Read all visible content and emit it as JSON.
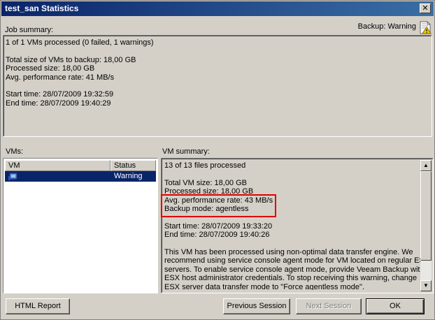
{
  "window": {
    "title": "test_san Statistics",
    "close_glyph": "✕"
  },
  "job": {
    "label": "Job summary:",
    "backup_label": "Backup:",
    "backup_status": "Warning",
    "lines": [
      "1 of 1 VMs processed (0 failed, 1 warnings)",
      "",
      "Total size of VMs to backup: 18,00 GB",
      "Processed size: 18,00 GB",
      "Avg. performance rate: 41 MB/s",
      "",
      "Start time: 28/07/2009 19:32:59",
      "End time: 28/07/2009 19:40:29"
    ]
  },
  "vms": {
    "label": "VMs:",
    "columns": [
      "VM",
      "Status"
    ],
    "rows": [
      {
        "name": "",
        "status": "Warning"
      }
    ]
  },
  "vm_summary": {
    "label": "VM summary:",
    "lines": [
      "13 of 13 files processed",
      "",
      "Total VM size: 18,00 GB",
      "Processed size: 18,00 GB",
      "Avg. performance rate: 43 MB/s",
      "Backup mode: agentless",
      "",
      "Start time: 28/07/2009 19:33:20",
      "End time: 28/07/2009 19:40:26",
      "",
      "This VM has been processed using non-optimal data transfer engine. We",
      "recommend using service console agent mode for VM located on regular ESX",
      "servers. To enable service console agent mode, provide Veeam Backup with",
      "ESX host administrator credentials. To stop receiving this warning, change",
      "ESX server data transfer mode to \"Force agentless mode\"."
    ]
  },
  "buttons": {
    "html_report": "HTML Report",
    "previous_session": "Previous Session",
    "next_session": "Next Session",
    "ok": "OK"
  },
  "colors": {
    "selection": "#0a246a",
    "highlight_box": "#e00000",
    "title_gradient_start": "#0a246a",
    "title_gradient_end": "#3a6ea5"
  },
  "icons": {
    "warning_doc": "warning-document-icon",
    "vm": "vm-icon",
    "scroll_up": "▲",
    "scroll_down": "▼"
  }
}
